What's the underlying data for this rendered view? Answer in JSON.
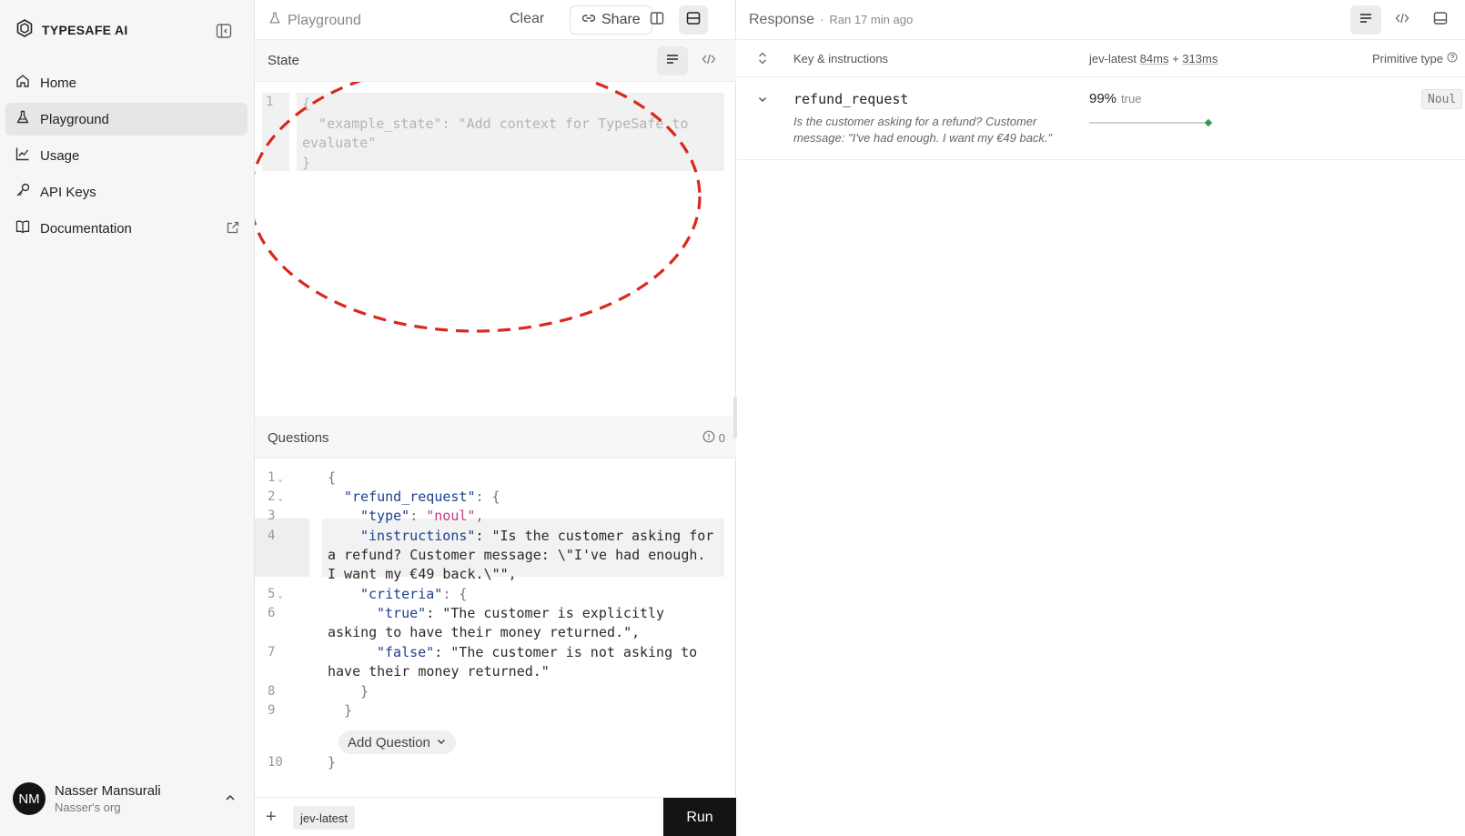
{
  "brand": {
    "name": "TYPESAFE AI"
  },
  "sidebar": {
    "items": [
      {
        "label": "Home",
        "icon": "home-icon",
        "active": false
      },
      {
        "label": "Playground",
        "icon": "flask-icon",
        "active": true
      },
      {
        "label": "Usage",
        "icon": "chart-line-icon",
        "active": false
      },
      {
        "label": "API Keys",
        "icon": "key-icon",
        "active": false
      },
      {
        "label": "Documentation",
        "icon": "book-icon",
        "active": false,
        "external": true
      }
    ],
    "user": {
      "initials": "NM",
      "name": "Nasser Mansurali",
      "org": "Nasser's org"
    }
  },
  "playground": {
    "title": "Playground",
    "clear_label": "Clear",
    "share_label": "Share"
  },
  "state": {
    "title": "State",
    "line_number": "1",
    "placeholder_lines": [
      "{",
      "  \"example_state\": \"Add context for TypeSafe to",
      "evaluate\"",
      "}"
    ]
  },
  "questions": {
    "title": "Questions",
    "count": "0",
    "line_numbers": [
      "1",
      "2",
      "3",
      "4",
      "5",
      "6",
      "7",
      "8",
      "9",
      "10"
    ],
    "add_label": "Add Question"
  },
  "code": {
    "l1": "{",
    "l2_key": "\"refund_request\"",
    "l2_rest": ": {",
    "l3_key": "\"type\"",
    "l3_sep": ": ",
    "l3_val": "\"noul\"",
    "l3_end": ",",
    "l4_key": "\"instructions\"",
    "l4_rest": ": \"Is the customer asking for",
    "l4b": "a refund? Customer message: \\\"I've had enough.",
    "l4c": "I want my €49 back.\\\"\",",
    "l5_key": "\"criteria\"",
    "l5_rest": ": {",
    "l6_key": "\"true\"",
    "l6_rest": ": \"The customer is explicitly",
    "l6b": "asking to have their money returned.\",",
    "l7_key": "\"false\"",
    "l7_rest": ": \"The customer is not asking to",
    "l7b": "have their money returned.\"",
    "l8": "}",
    "l9": "}",
    "l10": "}"
  },
  "bottom": {
    "model": "jev-latest",
    "run_label": "Run"
  },
  "response": {
    "title": "Response",
    "separator": "·",
    "ran": "Ran 17 min ago",
    "columns": {
      "key": "Key & instructions",
      "model": "jev-latest",
      "latency_a": "84ms",
      "plus": "+",
      "latency_b": "313ms",
      "ptype": "Primitive type"
    },
    "rows": [
      {
        "name": "refund_request",
        "instructions": "Is the customer asking for a refund? Customer message: \"I've had enough. I want my €49 back.\"",
        "percent": "99%",
        "value": "true",
        "confidence": 0.99,
        "type": "Noul"
      }
    ]
  },
  "colors": {
    "accent_dark": "#141414",
    "confidence_dot": "#2e9b5c",
    "annotation": "#d9281c",
    "json_key": "#1f3f8f",
    "json_enum": "#c03a8a"
  }
}
